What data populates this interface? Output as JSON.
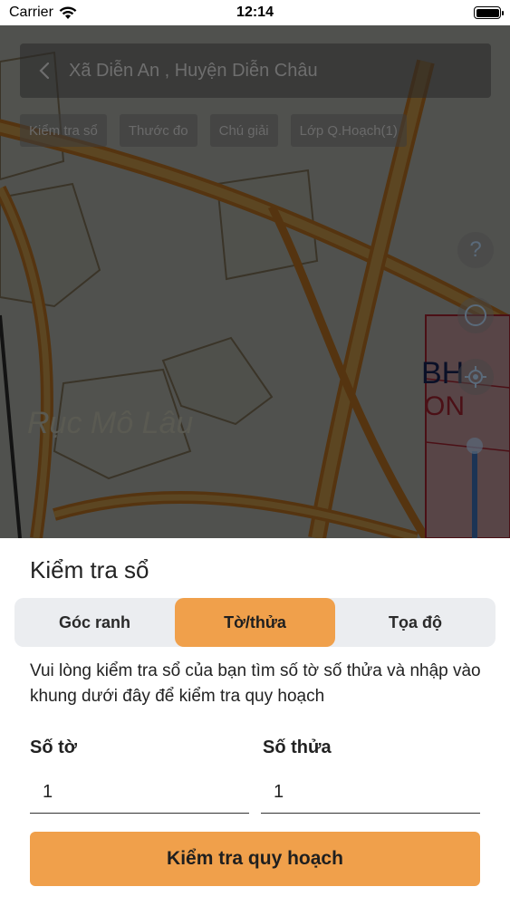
{
  "status_bar": {
    "carrier": "Carrier",
    "time": "12:14"
  },
  "map": {
    "search_title": "Xã Diễn An , Huyện Diễn Châu",
    "chips": [
      "Kiểm tra sổ",
      "Thước đo",
      "Chú giải",
      "Lớp Q.Hoạch(1)"
    ],
    "place_label": "Rục Mô Lâu",
    "tools": {
      "help": "?"
    }
  },
  "sheet": {
    "title": "Kiểm tra sổ",
    "tabs": [
      {
        "label": "Góc ranh",
        "active": false
      },
      {
        "label": "Tờ/thửa",
        "active": true
      },
      {
        "label": "Tọa độ",
        "active": false
      }
    ],
    "description": "Vui lòng kiểm tra sổ của bạn tìm số tờ số thửa và nhập vào khung dưới đây để kiểm tra quy hoạch",
    "fields": {
      "so_to": {
        "label": "Số tờ",
        "value": "1"
      },
      "so_thua": {
        "label": "Số thửa",
        "value": "1"
      }
    },
    "submit_label": "Kiểm tra quy hoạch"
  },
  "colors": {
    "accent": "#f0a04b",
    "segment_bg": "#ebedf0"
  }
}
